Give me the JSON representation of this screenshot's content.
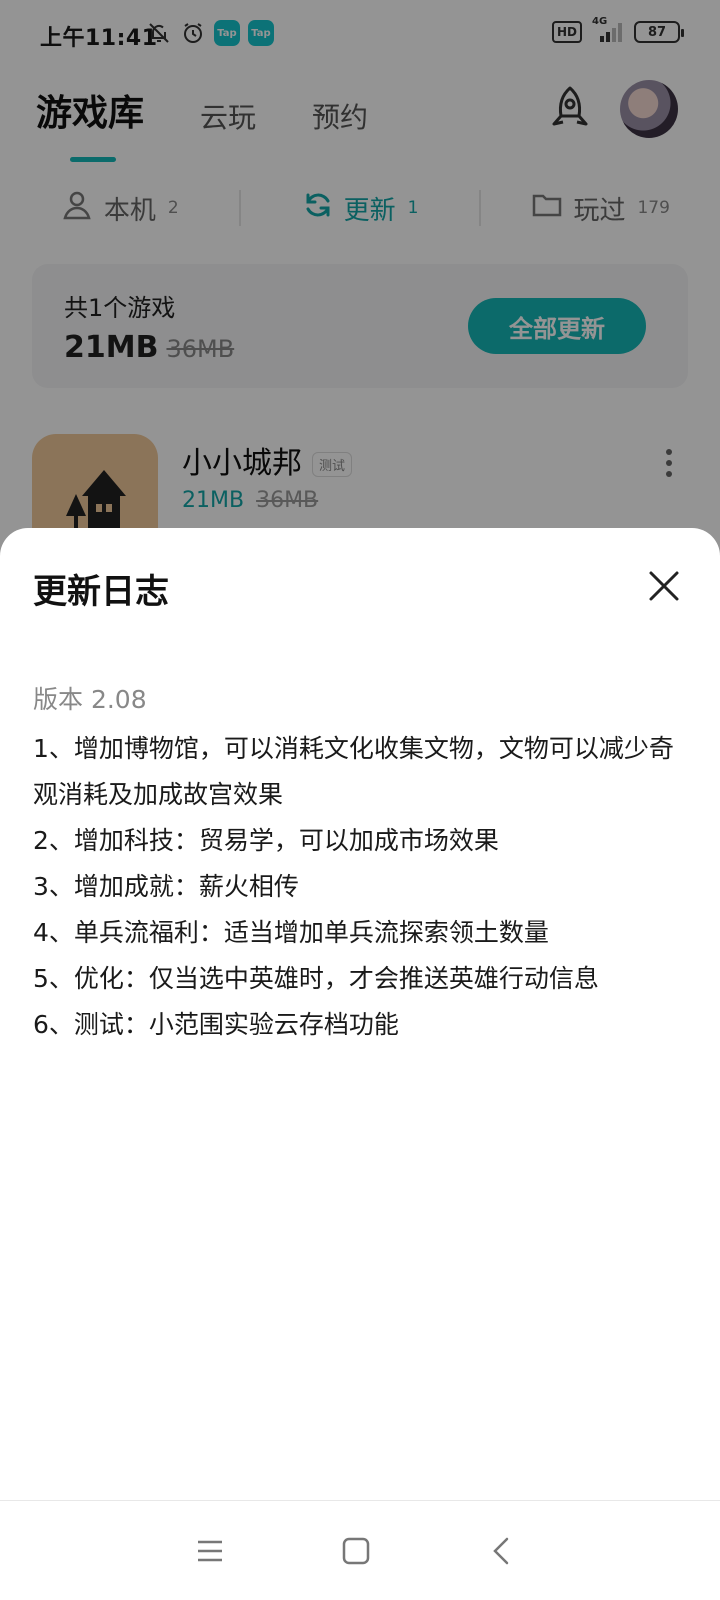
{
  "status_bar": {
    "time": "上午11:41",
    "left_icons": [
      "bell-off-icon",
      "alarm-icon",
      "tap-app-icon",
      "tap-app-icon"
    ],
    "tap_label": "Tap",
    "hd_label": "HD",
    "network_label": "4G",
    "battery": "87"
  },
  "header": {
    "tabs": [
      {
        "label": "游戏库",
        "active": true
      },
      {
        "label": "云玩",
        "active": false
      },
      {
        "label": "预约",
        "active": false
      }
    ]
  },
  "sub_tabs": [
    {
      "label": "本机",
      "count": "2",
      "icon": "device-icon",
      "active": false
    },
    {
      "label": "更新",
      "count": "1",
      "icon": "refresh-icon",
      "active": true
    },
    {
      "label": "玩过",
      "count": "179",
      "icon": "folder-icon",
      "active": false
    }
  ],
  "summary": {
    "count_text": "共1个游戏",
    "size": "21MB",
    "old_size": "36MB",
    "update_all_label": "全部更新"
  },
  "game": {
    "name": "小小城邦",
    "tag": "测试",
    "size": "21MB",
    "old_size": "36MB"
  },
  "changelog_sheet": {
    "title": "更新日志",
    "version": "版本 2.08",
    "items": [
      "1、增加博物馆，可以消耗文化收集文物，文物可以减少奇观消耗及加成故宫效果",
      "2、增加科技：贸易学，可以加成市场效果",
      "3、增加成就：薪火相传",
      "4、单兵流福利：适当增加单兵流探索领土数量",
      "5、优化：仅当选中英雄时，才会推送英雄行动信息",
      "6、测试：小范围实验云存档功能"
    ]
  },
  "colors": {
    "accent": "#16b7b7",
    "overlay": "rgba(0,0,0,0.42)"
  }
}
